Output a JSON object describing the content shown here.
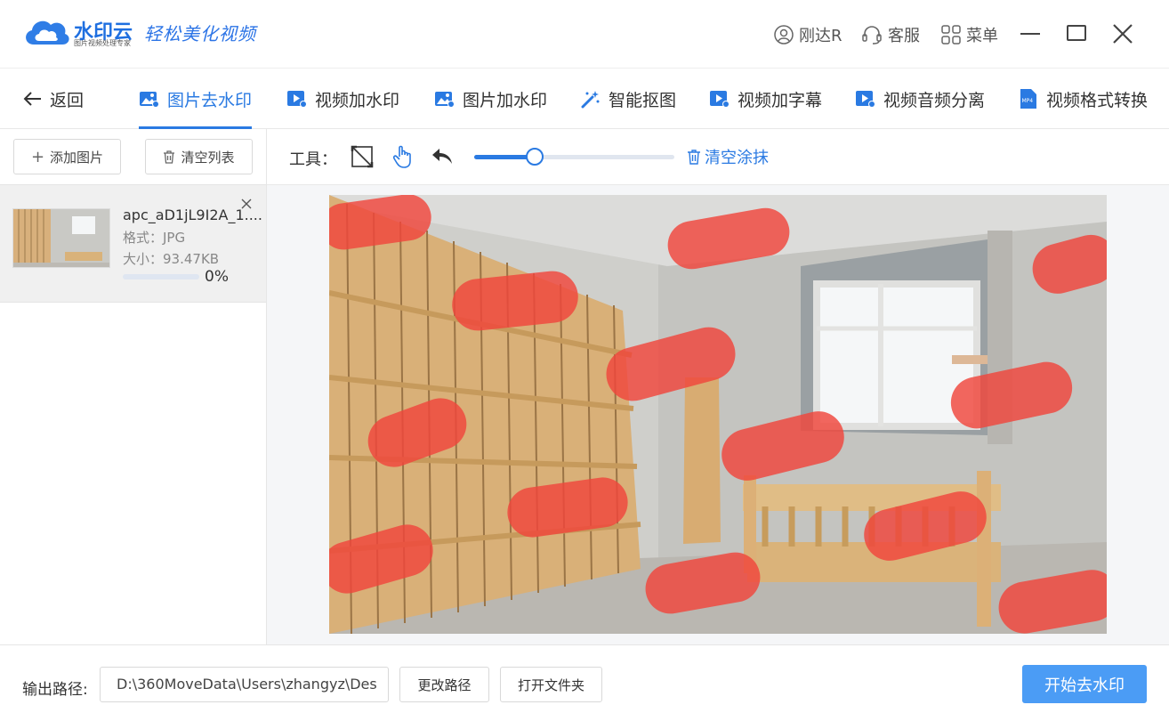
{
  "app": {
    "brand": "水印云",
    "brand_sub": "图片视频处理专家",
    "slogan": "轻松美化视频"
  },
  "titlebar": {
    "user": "刚达R",
    "service": "客服",
    "menu": "菜单"
  },
  "nav": {
    "back": "返回",
    "tabs": [
      {
        "label": "图片去水印",
        "active": true
      },
      {
        "label": "视频加水印"
      },
      {
        "label": "图片加水印"
      },
      {
        "label": "智能抠图"
      },
      {
        "label": "视频加字幕"
      },
      {
        "label": "视频音频分离"
      },
      {
        "label": "视频格式转换"
      }
    ]
  },
  "sidebar": {
    "add_label": "添加图片",
    "clear_label": "清空列表",
    "files": [
      {
        "name": "apc_aD1jL9I2A_1....",
        "format": "格式：JPG",
        "size": "大小：93.47KB",
        "progress": "0%"
      }
    ]
  },
  "toolbar": {
    "label": "工具：",
    "brush_size": 0.3,
    "clear_label": "清空涂抹"
  },
  "bottom": {
    "output_label": "输出路径:",
    "output_path": "D:\\360MoveData\\Users\\zhangyz\\Des",
    "change_path": "更改路径",
    "open_folder": "打开文件夹",
    "start": "开始去水印"
  },
  "colors": {
    "accent": "#2a7ae2",
    "start_button": "#4b9cf5",
    "mask_red": "#f0463c"
  }
}
